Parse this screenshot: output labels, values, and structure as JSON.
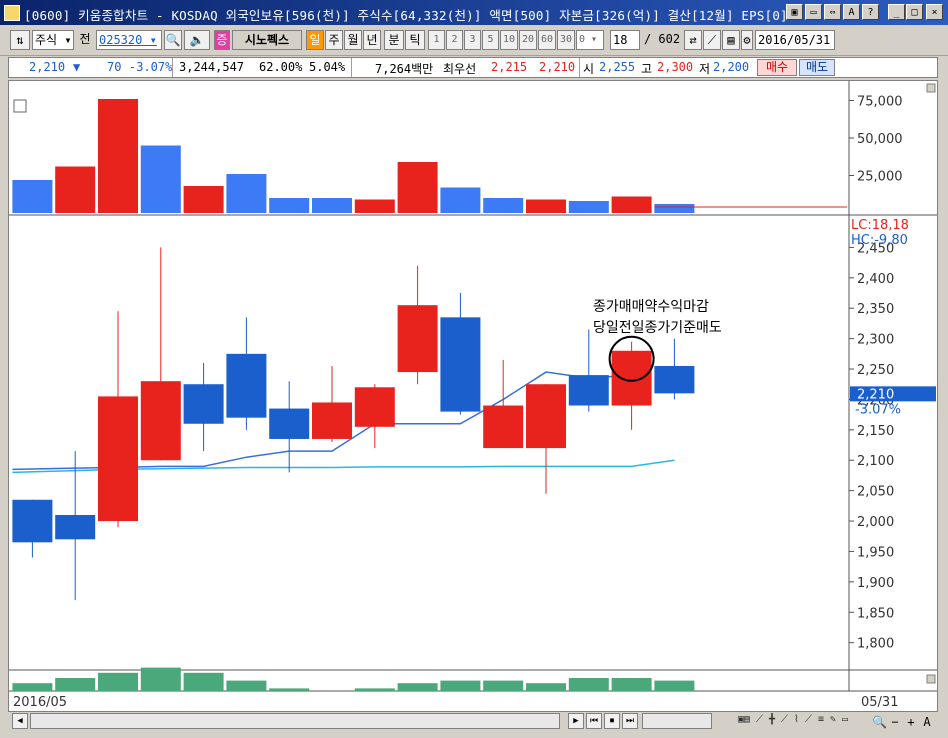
{
  "window": {
    "title": "[0600] 키움종합차트 - KOSDAQ 외국인보유[596(천)] 주식수[64,332(천)] 액면[500] 자본금[326(억)] 결산[12월] EPS[0]"
  },
  "toolbar": {
    "market_type": "주식",
    "prev_label": "전",
    "code": "025320",
    "stock_name": "시노펙스",
    "period_buttons": [
      "일",
      "주",
      "월",
      "년",
      "분",
      "틱"
    ],
    "interval_buttons": [
      "1",
      "2",
      "3",
      "5",
      "10",
      "20",
      "60",
      "30"
    ],
    "interval_input": "0",
    "count_value": "18",
    "total_count": "/ 602",
    "date": "2016/05/31"
  },
  "price_bar": {
    "price": "2,210",
    "change": "70",
    "change_rate": "-3.07%",
    "volume": "3,244,547",
    "ratio1": "62.00%",
    "ratio2": "5.04%",
    "amount": "7,264백만",
    "best_label": "최우선",
    "best_ask": "2,215",
    "best_bid": "2,210",
    "open_label": "시",
    "open": "2,255",
    "high_label": "고",
    "high": "2,300",
    "low_label": "저",
    "low": "2,200",
    "buy_button": "매수",
    "sell_button": "매도"
  },
  "colors": {
    "up": "#e8231e",
    "down": "#1a5fcc",
    "ma5": "#3a6fd8",
    "ma20": "#29b6e6",
    "volume_down": "#3d7af5"
  },
  "annotation": {
    "line1": "종가매매약수익마감",
    "line2": "당일전일종가기준매도"
  },
  "chart_data": [
    {
      "type": "candlestick",
      "name": "price",
      "x": [
        "d1",
        "d2",
        "d3",
        "d4",
        "d5",
        "d6",
        "d7",
        "d8",
        "d9",
        "d10",
        "d11",
        "d12",
        "d13",
        "d14",
        "d15",
        "d16"
      ],
      "open": [
        2035,
        2010,
        2000,
        2100,
        2225,
        2275,
        2185,
        2135,
        2155,
        2245,
        2335,
        2120,
        2120,
        2240,
        2190,
        2255
      ],
      "close": [
        1965,
        1970,
        2205,
        2230,
        2160,
        2170,
        2135,
        2195,
        2220,
        2355,
        2180,
        2190,
        2225,
        2190,
        2280,
        2210
      ],
      "high": [
        2035,
        2115,
        2345,
        2450,
        2260,
        2335,
        2230,
        2255,
        2225,
        2420,
        2375,
        2265,
        2225,
        2315,
        2295,
        2300
      ],
      "low": [
        1940,
        1870,
        1990,
        2100,
        2115,
        2150,
        2080,
        2130,
        2120,
        2225,
        2175,
        2120,
        2045,
        2180,
        2150,
        2200
      ],
      "ma5": [
        2085,
        2087,
        2088,
        2090,
        2090,
        2105,
        2115,
        2115,
        2160,
        2160,
        2160,
        2200,
        2245,
        2235,
        2240,
        null
      ],
      "ma20": [
        2080,
        2083,
        2085,
        2086,
        2087,
        2088,
        2088,
        2088,
        2089,
        2089,
        2089,
        2090,
        2090,
        2090,
        2090,
        2100
      ],
      "ylim": [
        1760,
        2500
      ],
      "yticks": [
        "2,450",
        "2,400",
        "2,350",
        "2,300",
        "2,250",
        "2,200",
        "2,150",
        "2,100",
        "2,050",
        "2,000",
        "1,950",
        "1,900",
        "1,850",
        "1,800"
      ],
      "ytick_values": [
        2450,
        2400,
        2350,
        2300,
        2250,
        2200,
        2150,
        2100,
        2050,
        2000,
        1950,
        1900,
        1850,
        1800
      ],
      "last_price_label": "2,210",
      "last_change_label": "-3.07%",
      "lc_label": "LC:18,18",
      "hc_label": "HC:-9,80"
    },
    {
      "type": "bar",
      "name": "volume",
      "values": [
        22000,
        31000,
        76000,
        45000,
        18000,
        26000,
        10000,
        10000,
        9000,
        34000,
        17000,
        10000,
        9000,
        8000,
        11000,
        6000
      ],
      "up": [
        false,
        true,
        true,
        false,
        true,
        false,
        false,
        false,
        true,
        true,
        false,
        false,
        true,
        false,
        true,
        false
      ],
      "ylim": [
        0,
        80000
      ],
      "yticks": [
        "75,000",
        "50,000",
        "25,000"
      ],
      "ytick_values": [
        75000,
        50000,
        25000
      ]
    },
    {
      "type": "bar",
      "name": "sub_indicator",
      "values": [
        3,
        5,
        7,
        9,
        7,
        4,
        1,
        0,
        1,
        3,
        4,
        4,
        3,
        5,
        5,
        4
      ],
      "ylim": [
        0,
        10
      ]
    }
  ],
  "xaxis": {
    "start_label": "2016/05",
    "end_label": "05/31"
  }
}
